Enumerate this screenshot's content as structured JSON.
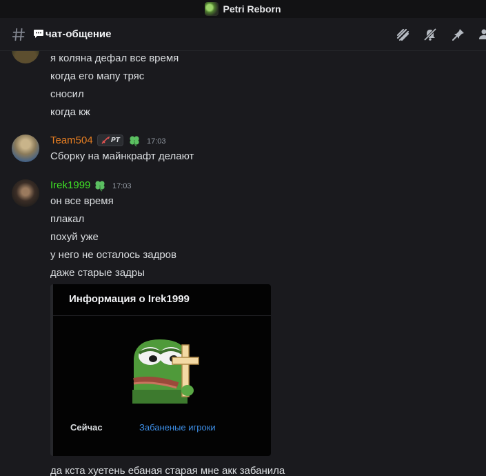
{
  "window": {
    "title": "Petri Reborn",
    "server_icon": "server-icon"
  },
  "header": {
    "channel_icon": "hash-icon",
    "channel_emoji": "speech-bubble-icon",
    "channel_name": "чат-общение",
    "icons": [
      "threads-icon",
      "mute-bell-icon",
      "pin-icon",
      "members-icon"
    ]
  },
  "messages": [
    {
      "avatar": "avatar-partial",
      "lines": [
        "я коляна дефал все время",
        "когда его мапу тряс",
        "сносил",
        "когда кж"
      ]
    },
    {
      "author": "Team504",
      "author_color": "#e67e22",
      "tag": "PT",
      "badge": "clover-icon",
      "timestamp": "17:03",
      "lines": [
        "Сборку на майнкрафт делают"
      ]
    },
    {
      "author": "Irek1999",
      "author_color": "#3ee025",
      "badge": "clover-icon",
      "timestamp": "17:03",
      "lines": [
        "он все время",
        "плакал",
        "похуй уже",
        "у него не осталось задров",
        "даже старые задры"
      ],
      "embed": {
        "title": "Информация о Irek1999",
        "image": "pepe-cross-emoji",
        "fields": [
          {
            "label": "Сейчас",
            "color": "#dbdee1"
          },
          {
            "label": "Забаненые игроки",
            "color": "#3d8ee6"
          }
        ]
      },
      "after_embed": "да кста хуетень ебаная старая мне акк забанила"
    }
  ],
  "colors": {
    "background": "#1a1a1e",
    "titlebar": "#121214",
    "embed_bg": "#030303",
    "text": "#dbdee1"
  }
}
